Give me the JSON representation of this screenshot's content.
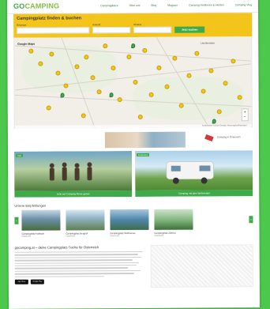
{
  "header": {
    "logo_part1": "GO",
    "logo_part2": "CAMPING",
    "nav": [
      "Campingplätze",
      "Über uns",
      "Blog",
      "Magazin",
      "Camping Heldinnen & Helden",
      "Camping Vlog"
    ]
  },
  "search": {
    "title": "Campingplatz finden & buchen",
    "fields": [
      {
        "label": "Reiseziel",
        "value": ""
      },
      {
        "label": "Ankunft",
        "value": ""
      },
      {
        "label": "Abreise",
        "value": ""
      }
    ],
    "button_label": "Jetzt suchen"
  },
  "map": {
    "label_left": "Google Maps",
    "label_right": "Liechtenstein",
    "zoom_plus": "+",
    "zoom_minus": "−",
    "footer": "Kartendaten ©2024 Google, Nutzungsbedingungen"
  },
  "promo": {
    "text": "Camping in Österreich"
  },
  "cards": [
    {
      "tag": "Tipp",
      "label": "Jetzt auf Camping-Reise gehen"
    },
    {
      "tag": "Entdecken",
      "label": "Camping mit dem Wohnmobil"
    }
  ],
  "experiences": {
    "title": "Unsere Empfehlungen",
    "items": [
      {
        "name": "Campingplatz Hallstatt",
        "sub": "Österreich"
      },
      {
        "name": "Campingplatz Berghof",
        "sub": "Österreich"
      },
      {
        "name": "Campingplatz Wörthersee",
        "sub": "Österreich"
      },
      {
        "name": "Campingplatz Zillertal",
        "sub": "Österreich"
      }
    ]
  },
  "about": {
    "title": "gocamping.at – deine Campingplatz-Suche für Österreich"
  },
  "apps": {
    "ios": "App Store",
    "android": "Google Play"
  },
  "colors": {
    "brand_green": "#3faa4a",
    "brand_yellow": "#f3c51a",
    "page_background": "#4cc94c"
  }
}
